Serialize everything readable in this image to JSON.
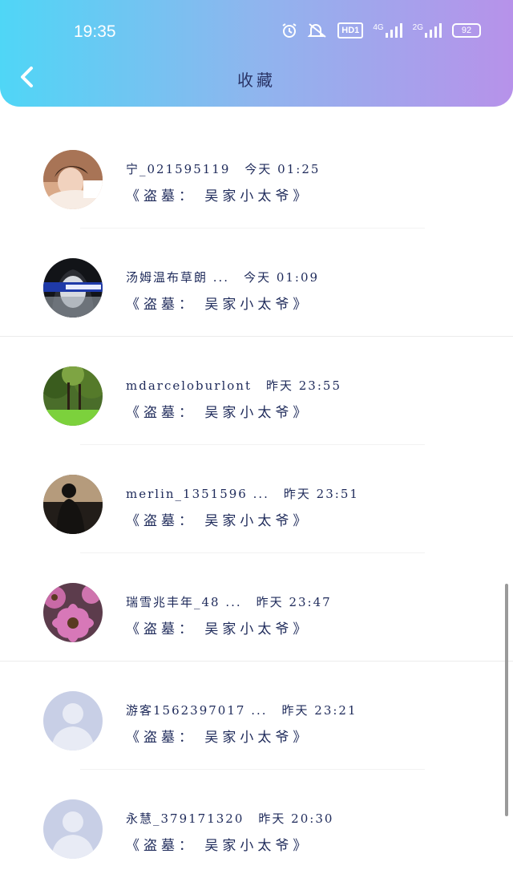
{
  "status_bar": {
    "time": "19:35",
    "icons": [
      "alarm-icon",
      "mute-icon"
    ],
    "hd_label": "HD1",
    "signal_1_label": "4G",
    "signal_2_label": "2G",
    "battery_level": "92"
  },
  "header": {
    "title": "收藏",
    "back_icon": "chevron-left-icon"
  },
  "items": [
    {
      "name": "宁_021595119",
      "date": "今天 01:25",
      "title": "《盗墓：  吴家小太爷》",
      "avatar": "photo-girl"
    },
    {
      "name": "汤姆温布草朗 ...",
      "date": "今天 01:09",
      "title": "《盗墓：  吴家小太爷》",
      "avatar": "photo-portrait"
    },
    {
      "name": "mdarceloburlont",
      "date": "昨天 23:55",
      "title": "《盗墓：  吴家小太爷》",
      "avatar": "photo-forest"
    },
    {
      "name": "merlin_1351596 ...",
      "date": "昨天 23:51",
      "title": "《盗墓：  吴家小太爷》",
      "avatar": "photo-silhouette"
    },
    {
      "name": "瑞雪兆丰年_48 ...",
      "date": "昨天 23:47",
      "title": "《盗墓：  吴家小太爷》",
      "avatar": "photo-flower"
    },
    {
      "name": "游客1562397017 ...",
      "date": "昨天 23:21",
      "title": "《盗墓：  吴家小太爷》",
      "avatar": "default-avatar"
    },
    {
      "name": "永慧_379171320",
      "date": "昨天 20:30",
      "title": "《盗墓：  吴家小太爷》",
      "avatar": "default-avatar"
    }
  ]
}
